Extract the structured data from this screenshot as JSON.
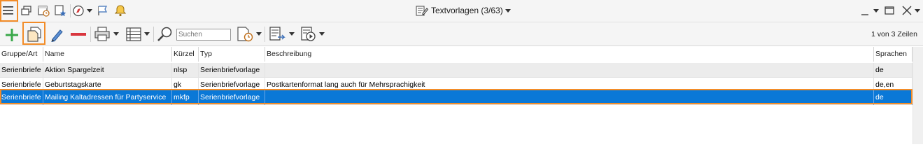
{
  "window": {
    "title": "Textvorlagen (3/63)"
  },
  "toolbar": {
    "search_placeholder": "Suchen",
    "row_count": "1 von 3 Zeilen"
  },
  "table": {
    "columns": [
      "Gruppe/Art",
      "Name",
      "Kürzel",
      "Typ",
      "Beschreibung",
      "Sprachen"
    ],
    "rows": [
      [
        "Serienbriefe",
        "Aktion Spargelzeit",
        "nlsp",
        "Serienbriefvorlage",
        "",
        "de"
      ],
      [
        "Serienbriefe",
        "Geburtstagskarte",
        "gk",
        "Serienbriefvorlage",
        "Postkartenformat lang auch für Mehrsprachigkeit",
        "de,en"
      ],
      [
        "Serienbriefe",
        "Mailing Kaltadressen für Partyservice",
        "mkfp",
        "Serienbriefvorlage",
        "",
        "de"
      ]
    ],
    "selected_row_index": 2
  },
  "colors": {
    "highlight": "#f28c28",
    "selection": "#0a78d7",
    "add_green": "#3aa84a",
    "delete_red": "#d9363e"
  },
  "icons": [
    "menu-icon",
    "windows-icon",
    "calendar-clock-icon",
    "favorites-icon",
    "navigation-icon",
    "flag-icon",
    "bell-icon",
    "document-edit-icon",
    "add-icon",
    "copy-icon",
    "edit-icon",
    "delete-icon",
    "print-icon",
    "list-view-icon",
    "search-icon",
    "calendar-filter-icon",
    "export-icon",
    "media-icon",
    "minimize-icon",
    "restore-icon",
    "close-icon"
  ]
}
